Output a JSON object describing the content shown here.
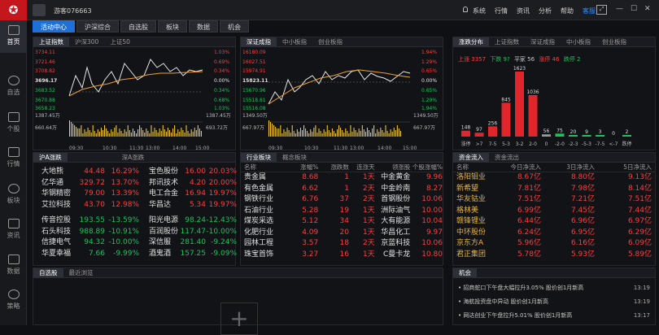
{
  "topbar": {
    "user": "游客076663",
    "menu": [
      "系统",
      "行情",
      "资讯",
      "分析",
      "帮助",
      "客服"
    ],
    "active_menu": "客服"
  },
  "sidebar": [
    {
      "label": "首页"
    },
    {
      "label": "自选"
    },
    {
      "label": "个股"
    },
    {
      "label": "行情"
    },
    {
      "label": "板块"
    },
    {
      "label": "资讯"
    },
    {
      "label": "数据"
    },
    {
      "label": "策略"
    }
  ],
  "nav": [
    "活动中心",
    "沪深综合",
    "自选股",
    "板块",
    "数据",
    "机会"
  ],
  "index_panel1": {
    "tabs": [
      "上证指数",
      "沪深300",
      "上证50"
    ],
    "left": [
      "3734.11",
      "3721.46",
      "3708.82",
      "3696.17",
      "3683.52",
      "3670.88",
      "3658.23",
      "1387.45万",
      "693.72万",
      "660.64万"
    ],
    "right": [
      "1.03%",
      "0.69%",
      "0.34%",
      "0.00%",
      "0.34%",
      "0.68%",
      "1.03%",
      "1387.45万",
      "693.72万"
    ],
    "times": [
      "09:30",
      "10:30",
      "11:30",
      "13:00",
      "14:00",
      "15:00"
    ]
  },
  "index_panel2": {
    "tabs": [
      "深证成指",
      "中小板指",
      "创业板指"
    ],
    "left": [
      "16180.09",
      "16027.51",
      "15974.91",
      "15823.11",
      "15670.96",
      "15518.81",
      "15516.08",
      "1349.50万",
      "667.97万"
    ],
    "right": [
      "1.94%",
      "1.29%",
      "0.65%",
      "0.00%",
      "0.65%",
      "1.29%",
      "1.94%",
      "1349.50万",
      "667.97万"
    ],
    "times": [
      "09:30",
      "10:30",
      "11:30",
      "13:00",
      "14:00",
      "15:00"
    ]
  },
  "dist": {
    "tabs": [
      "涨跌分布",
      "上证指数",
      "深证成指",
      "中小板指",
      "创业板指"
    ],
    "summary": [
      {
        "k": "上涨",
        "v": "3357"
      },
      {
        "k": "下跌",
        "v": "9?"
      },
      {
        "k": "平家",
        "v": "56"
      },
      {
        "k": "涨停",
        "v": "46"
      },
      {
        "k": "跌停",
        "v": "2"
      }
    ],
    "bars": [
      {
        "label": "涨停",
        "value": 148
      },
      {
        "label": ">7",
        "value": 97
      },
      {
        "label": "7-5",
        "value": 256
      },
      {
        "label": "5-3",
        "value": 845
      },
      {
        "label": "3-2",
        "value": 1623
      },
      {
        "label": "2-0",
        "value": 1036
      },
      {
        "label": "0",
        "value": 56
      },
      {
        "label": "-2-0",
        "value": 75
      },
      {
        "label": "-2-3",
        "value": 20
      },
      {
        "label": "-5-3",
        "value": 9
      },
      {
        "label": "-7-5",
        "value": 3
      },
      {
        "label": "<-7",
        "value": 0
      },
      {
        "label": "跌停",
        "value": 2
      }
    ]
  },
  "movers": {
    "tabs": [
      "沪A涨跌",
      "深A涨跌"
    ],
    "up_left": [
      [
        "大地熊",
        "44.48",
        "16.29%"
      ],
      [
        "亿华通",
        "329.72",
        "13.70%"
      ],
      [
        "华钢精密",
        "79.00",
        "13.39%"
      ],
      [
        "艾拉科技",
        "43.70",
        "12.98%"
      ]
    ],
    "up_right": [
      [
        "宝色股份",
        "16.00",
        "20.03%"
      ],
      [
        "邦讯技术",
        "4.20",
        "20.00%"
      ],
      [
        "电工合金",
        "16.94",
        "19.97%"
      ],
      [
        "华昌达",
        "5.34",
        "19.97%"
      ]
    ],
    "dn_left": [
      [
        "传音控股",
        "193.55",
        "-13.59%"
      ],
      [
        "石头科技",
        "988.89",
        "-10.91%"
      ],
      [
        "信捷电气",
        "94.32",
        "-10.00%"
      ],
      [
        "华夏幸福",
        "7.66",
        "-9.99%"
      ]
    ],
    "dn_right": [
      [
        "阳光电源",
        "98.24",
        "-12.43%"
      ],
      [
        "百润股份",
        "117.47",
        "-10.00%"
      ],
      [
        "深信服",
        "281.40",
        "-9.24%"
      ],
      [
        "酒鬼酒",
        "157.25",
        "-9.09%"
      ]
    ]
  },
  "industry": {
    "tabs": [
      "行业板块",
      "概念板块"
    ],
    "headers": [
      "名称",
      "涨幅%",
      "涨跌数",
      "连涨天",
      "领涨股",
      "个股涨幅%"
    ],
    "rows": [
      [
        "贵金属",
        "8.68",
        "1",
        "1天",
        "中金黄金",
        "9.96"
      ],
      [
        "有色金属",
        "6.62",
        "1",
        "2天",
        "中金岭南",
        "8.27"
      ],
      [
        "钢铁行业",
        "6.76",
        "37",
        "2天",
        "首钢股份",
        "10.06"
      ],
      [
        "石油行业",
        "5.28",
        "19",
        "1天",
        "洲际油气",
        "10.00"
      ],
      [
        "煤炭采选",
        "5.12",
        "34",
        "1天",
        "大有能源",
        "10.04"
      ],
      [
        "化肥行业",
        "4.09",
        "20",
        "1天",
        "华昌化工",
        "9.97"
      ],
      [
        "园林工程",
        "3.57",
        "18",
        "2天",
        "京蓝科技",
        "10.06"
      ],
      [
        "珠宝首饰",
        "3.27",
        "16",
        "1天",
        "C曼卡龙",
        "10.80"
      ]
    ]
  },
  "flow": {
    "tabs": [
      "资金流入",
      "资金流出"
    ],
    "headers": [
      "名称",
      "今日净流入",
      "3日净流入",
      "5日净流入"
    ],
    "rows": [
      [
        "洛阳钼业",
        "8.67亿",
        "8.80亿",
        "9.13亿"
      ],
      [
        "新希望",
        "7.81亿",
        "7.98亿",
        "8.14亿"
      ],
      [
        "华友钴业",
        "7.51亿",
        "7.21亿",
        "7.51亿"
      ],
      [
        "格林美",
        "6.99亿",
        "7.45亿",
        "7.44亿"
      ],
      [
        "赣锋锂业",
        "6.44亿",
        "6.96亿",
        "6.97亿"
      ],
      [
        "中环股份",
        "6.24亿",
        "6.95亿",
        "6.29亿"
      ],
      [
        "京东方A",
        "5.96亿",
        "6.16亿",
        "6.09亿"
      ],
      [
        "君正集团",
        "5.78亿",
        "5.93亿",
        "5.89亿"
      ]
    ]
  },
  "watch": {
    "tabs": [
      "自选股",
      "最近浏览"
    ]
  },
  "news": {
    "tabs": [
      "机会"
    ],
    "items": [
      {
        "text": "招商蛇口下午盘大幅拉升3.05% 股价创1月新高",
        "time": "13:19"
      },
      {
        "text": "海航投资盘中异动 股价创1月新高",
        "time": "13:19"
      },
      {
        "text": "网达创业下午盘拉升5.01% 股价创1月新高",
        "time": "13:17"
      }
    ]
  }
}
